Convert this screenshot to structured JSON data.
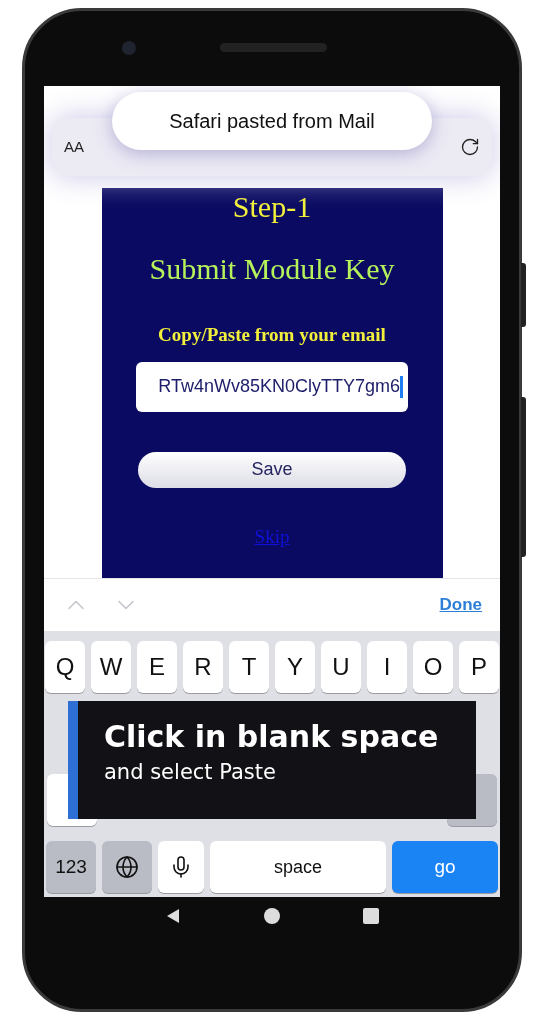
{
  "toast": {
    "text": "Safari pasted from Mail"
  },
  "address_bar": {
    "text_size_label": "AA"
  },
  "page": {
    "step_title": "Step-1",
    "heading": "Submit Module Key",
    "instruction": "Copy/Paste from your email",
    "key_field": {
      "value": "RTw4nWv85KN0ClyTTY7gm6"
    },
    "save_button": "Save",
    "skip_link": "Skip"
  },
  "accessory_bar": {
    "done": "Done"
  },
  "keyboard": {
    "row_1": [
      "Q",
      "W",
      "E",
      "R",
      "T",
      "Y",
      "U",
      "I",
      "O",
      "P"
    ],
    "bottom_row": [
      {
        "kind": "text",
        "label": "123"
      },
      {
        "kind": "globe"
      },
      {
        "kind": "mic"
      },
      {
        "kind": "space",
        "label": "space"
      },
      {
        "kind": "go",
        "label": "go"
      }
    ]
  },
  "callout": {
    "title": "Click in blank space",
    "subtitle": "and select Paste"
  }
}
